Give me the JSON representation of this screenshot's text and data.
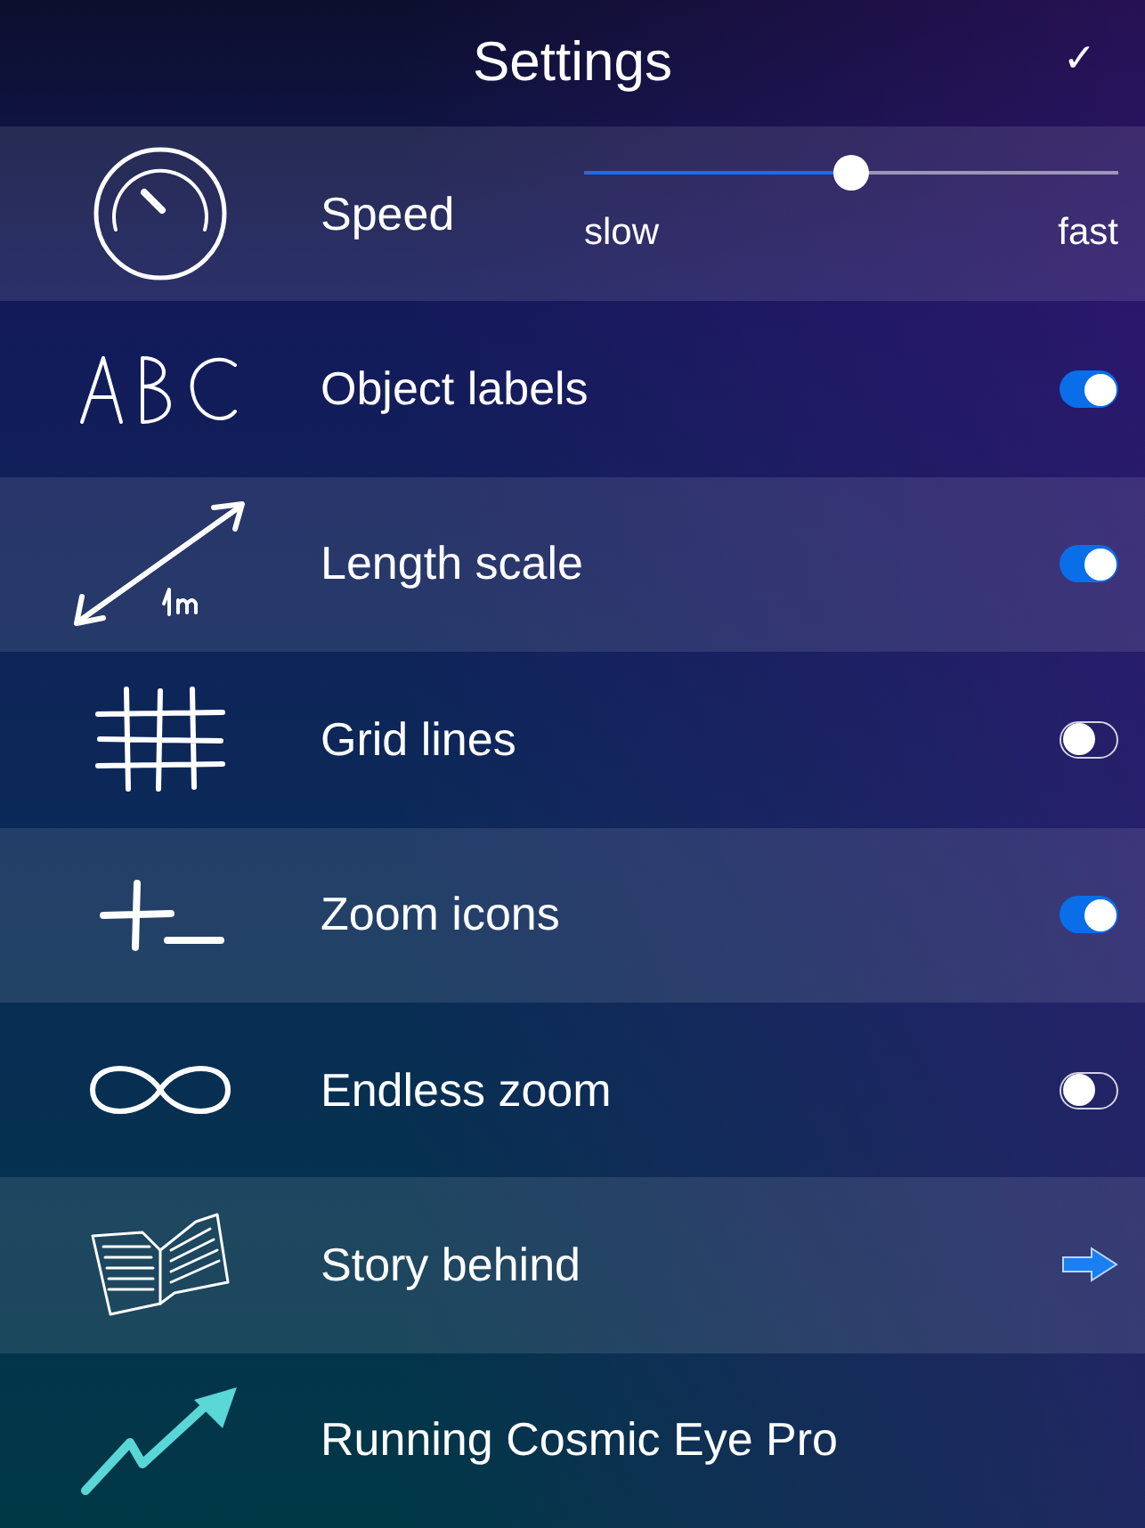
{
  "header": {
    "title": "Settings",
    "done": "✓"
  },
  "rows": [
    {
      "kind": "slider",
      "label": "Speed",
      "level": 0.5,
      "min_label": "slow",
      "max_label": "fast"
    },
    {
      "kind": "toggle",
      "label": "Object labels",
      "on": true
    },
    {
      "kind": "toggle",
      "label": "Length scale",
      "on": true
    },
    {
      "kind": "toggle",
      "label": "Grid lines",
      "on": false
    },
    {
      "kind": "toggle",
      "label": "Zoom icons",
      "on": true
    },
    {
      "kind": "toggle",
      "label": "Endless zoom",
      "on": false
    },
    {
      "kind": "link",
      "label": "Story behind"
    },
    {
      "kind": "plain",
      "label": "Running Cosmic Eye Pro"
    }
  ]
}
